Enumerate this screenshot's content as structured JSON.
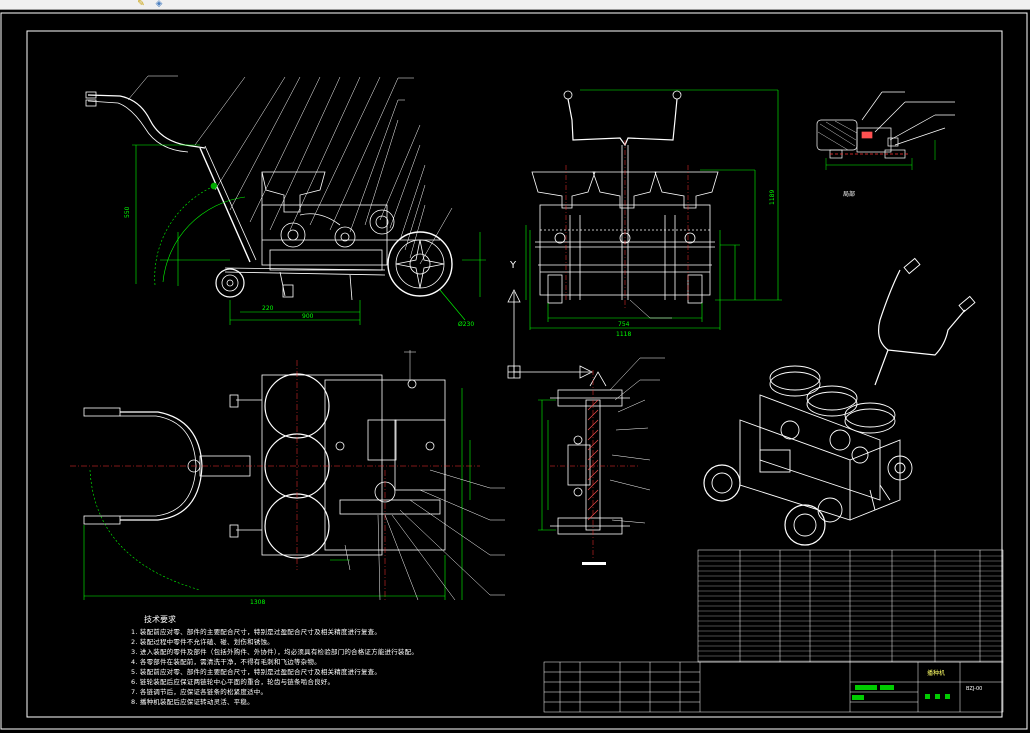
{
  "toolbar": {
    "icons": [
      "pencil-icon",
      "shield-icon"
    ]
  },
  "drawing": {
    "view_labels": {
      "axis_y": "Y",
      "detail_caption": "局部"
    },
    "dimensions": {
      "side_height": "550",
      "side_wheel_dia": "Ø230",
      "side_len_1": "220",
      "side_len_2": "900",
      "front_height": "1189",
      "front_width": "1118",
      "front_inner_width": "754",
      "top_width": "1308"
    },
    "tech_notes": {
      "title": "技术要求",
      "lines": [
        "1. 装配前应对零、部件的主要配合尺寸，特别是过盈配合尺寸及相关精度进行复查。",
        "2. 装配过程中零件不允许磕、碰、划伤和锈蚀。",
        "3. 进入装配的零件及部件（包括外购件、外协件），均必须具有检验部门的合格证方能进行装配。",
        "4. 各零部件在装配前，需清洗干净，不得有毛刺和飞边等杂物。",
        "5. 装配前应对零、部件的主要配合尺寸，特别是过盈配合尺寸及相关精度进行复查。",
        "6. 链轮装配后应保证两链轮中心平面的重合，轮齿与链条啮合良好。",
        "7. 各链调节后，应保证各链条的松紧度适中。",
        "8. 播种机装配后应保证转动灵活、平稳。"
      ]
    },
    "title_block": {
      "drawing_name": "播种机",
      "drawing_number": "BZJ-00"
    }
  }
}
